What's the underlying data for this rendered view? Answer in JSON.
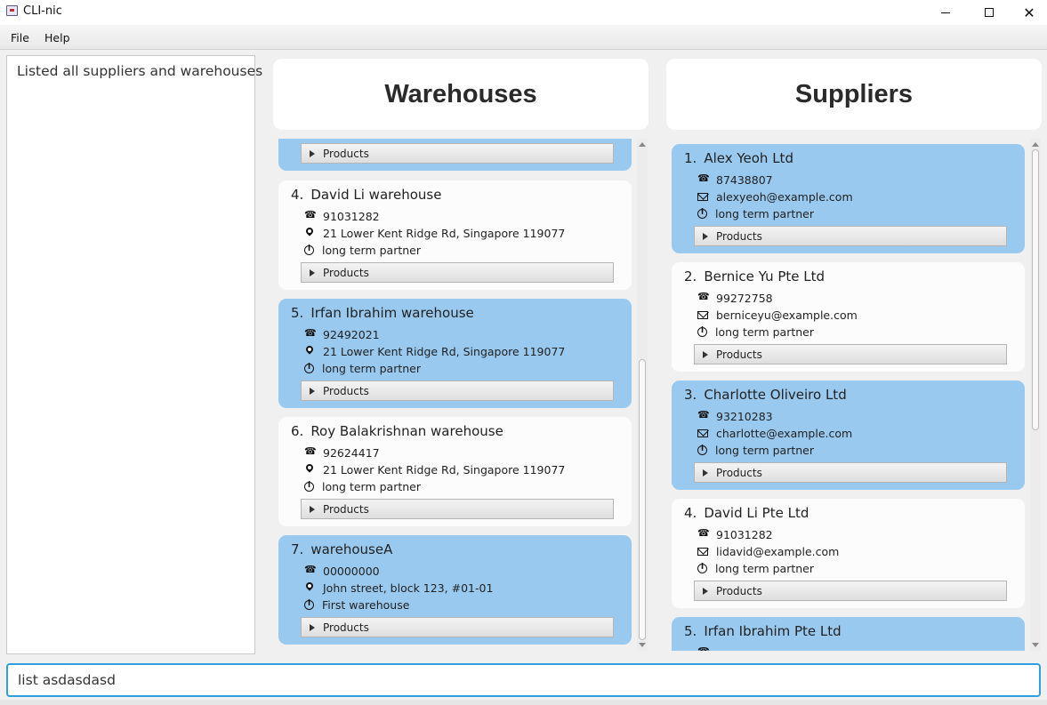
{
  "window": {
    "title": "CLI-nic"
  },
  "menu": {
    "file": "File",
    "help": "Help"
  },
  "result_text": "Listed all suppliers and warehouses",
  "warehouses": {
    "header": "Warehouses",
    "items": [
      {
        "index": "4.",
        "name": "David Li warehouse",
        "phone": "91031282",
        "address": "21 Lower Kent Ridge Rd, Singapore 119077",
        "remark": "long term partner",
        "products": "Products"
      },
      {
        "index": "5.",
        "name": "Irfan Ibrahim warehouse",
        "phone": "92492021",
        "address": "21 Lower Kent Ridge Rd, Singapore 119077",
        "remark": "long term partner",
        "products": "Products"
      },
      {
        "index": "6.",
        "name": "Roy Balakrishnan warehouse",
        "phone": "92624417",
        "address": "21 Lower Kent Ridge Rd, Singapore 119077",
        "remark": "long term partner",
        "products": "Products"
      },
      {
        "index": "7.",
        "name": "warehouseA",
        "phone": "00000000",
        "address": "John street, block 123, #01-01",
        "remark": "First warehouse",
        "products": "Products"
      }
    ],
    "partial_top": {
      "products": "Products"
    }
  },
  "suppliers": {
    "header": "Suppliers",
    "items": [
      {
        "index": "1.",
        "name": "Alex Yeoh Ltd",
        "phone": "87438807",
        "email": "alexyeoh@example.com",
        "remark": "long term partner",
        "products": "Products"
      },
      {
        "index": "2.",
        "name": "Bernice Yu Pte Ltd",
        "phone": "99272758",
        "email": "berniceyu@example.com",
        "remark": "long term partner",
        "products": "Products"
      },
      {
        "index": "3.",
        "name": "Charlotte Oliveiro Ltd",
        "phone": "93210283",
        "email": "charlotte@example.com",
        "remark": "long term partner",
        "products": "Products"
      },
      {
        "index": "4.",
        "name": "David Li Pte Ltd",
        "phone": "91031282",
        "email": "lidavid@example.com",
        "remark": "long term partner",
        "products": "Products"
      },
      {
        "index": "5.",
        "name": "Irfan Ibrahim Pte Ltd"
      }
    ]
  },
  "command": {
    "value": "list asdasdasd"
  },
  "colors": {
    "card_blue": "#9ac9ef",
    "card_white": "#fcfcfc",
    "command_border": "#2e9fe0"
  }
}
